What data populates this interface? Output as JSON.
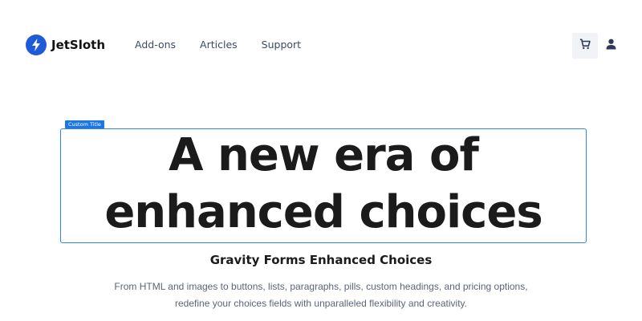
{
  "brand": {
    "name": "JetSloth",
    "accent": "#1f5bd6"
  },
  "nav": {
    "items": [
      {
        "label": "Add-ons"
      },
      {
        "label": "Articles"
      },
      {
        "label": "Support"
      }
    ]
  },
  "header_icons": {
    "cart": "cart-icon",
    "user": "user-icon"
  },
  "hero": {
    "tag": "Custom Title",
    "title": "A new era of enhanced choices",
    "subtitle": "Gravity Forms Enhanced Choices",
    "description": "From HTML and images to buttons, lists, paragraphs, pills, custom headings, and pricing options, redefine your choices fields with unparalleled flexibility and creativity.",
    "highlight_color": "#2f86e6"
  }
}
